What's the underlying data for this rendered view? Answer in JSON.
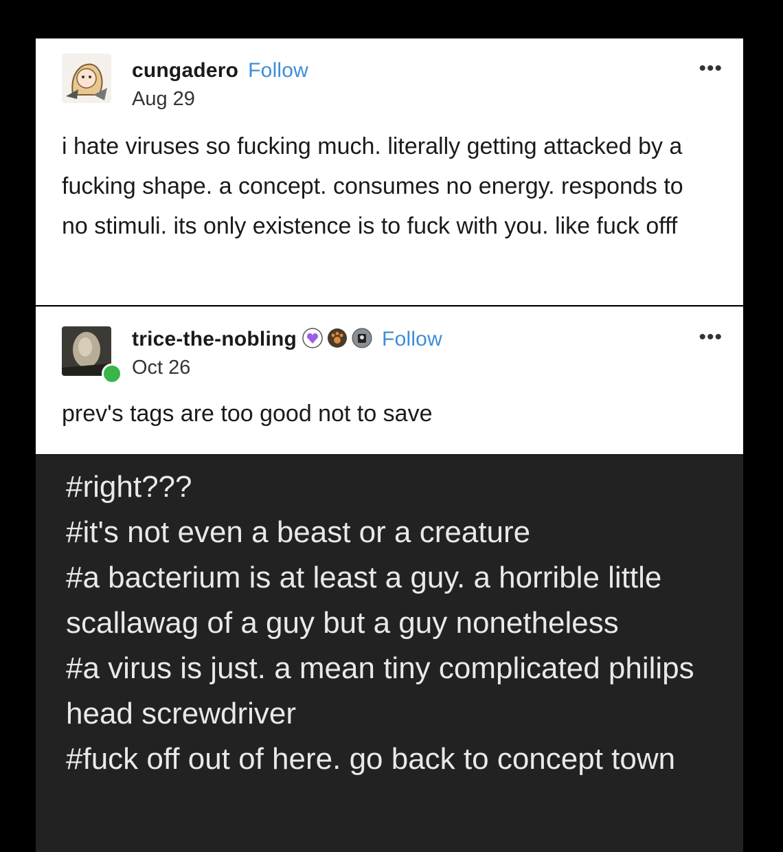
{
  "post1": {
    "username": "cungadero",
    "follow_label": "Follow",
    "date": "Aug 29",
    "more_label": "•••",
    "body": "i hate viruses so fucking much. literally getting attacked by a fucking shape. a concept. consumes no energy. responds to no stimuli. its only existence is to fuck with you. like fuck offf"
  },
  "post2": {
    "username": "trice-the-nobling",
    "follow_label": "Follow",
    "date": "Oct 26",
    "more_label": "•••",
    "body": "prev's tags are too good not to save",
    "badge_icons": [
      "purple-heart-badge-icon",
      "paw-badge-icon",
      "gray-badge-icon"
    ]
  },
  "tags": [
    "#right???",
    "#it's not even a beast or a creature",
    "#a bacterium is at least a guy. a horrible little scallawag of a guy but a guy nonetheless",
    "#a virus is just. a mean tiny complicated philips head screwdriver",
    "#fuck off out of here. go back to concept town"
  ],
  "colors": {
    "follow": "#3d8ed8",
    "tags_bg": "#222222",
    "tags_text": "#e9e9e9",
    "reblog_badge": "#39b54a"
  }
}
